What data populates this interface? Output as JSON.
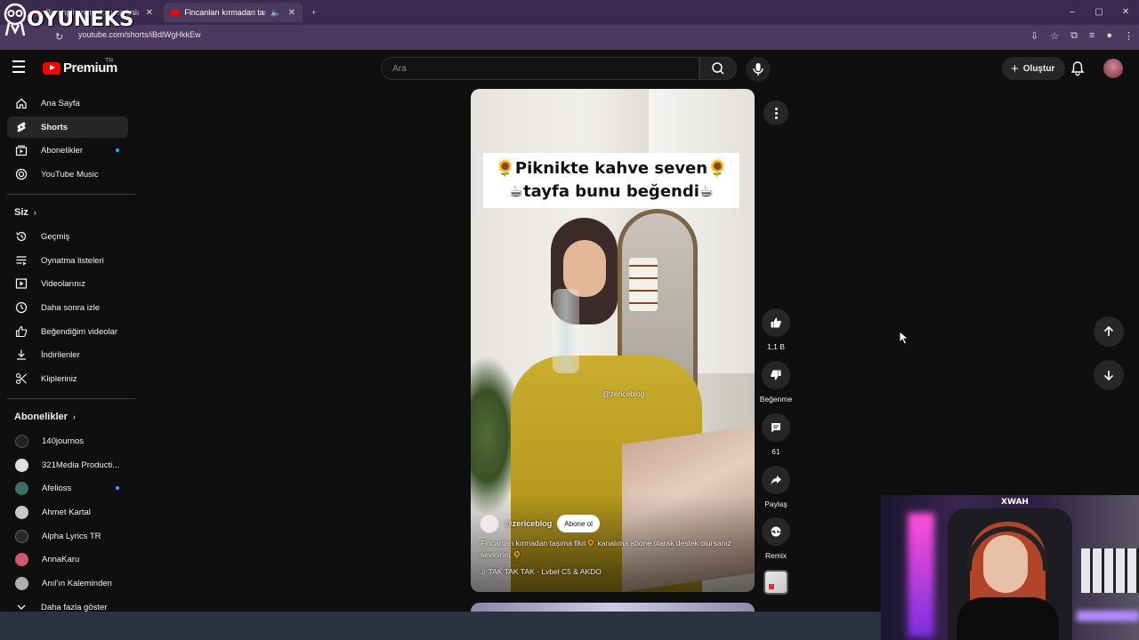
{
  "browser": {
    "tabs": [
      {
        "label": "Bu çhpli anime kızı zorbalanm...",
        "active": false
      },
      {
        "label": "Fincanları kırmadan taşıma",
        "active": true
      }
    ],
    "url": "youtube.com/shorts/iBdlWgHkkEw",
    "new_tab": "+",
    "window_controls": [
      "–",
      "▢",
      "✕"
    ]
  },
  "overlay_watermark": "OYUNEKS",
  "masthead": {
    "logo_text": "Premium",
    "country_code": "TR",
    "search_placeholder": "Ara",
    "create_label": "Oluştur"
  },
  "sidebar": {
    "main": [
      {
        "label": "Ana Sayfa",
        "icon": "home-icon"
      },
      {
        "label": "Shorts",
        "icon": "shorts-icon",
        "active": true
      },
      {
        "label": "Abonelikler",
        "icon": "subscriptions-icon",
        "dot": true
      },
      {
        "label": "YouTube Music",
        "icon": "music-icon"
      }
    ],
    "you_header": "Siz",
    "you": [
      {
        "label": "Geçmiş",
        "icon": "history-icon"
      },
      {
        "label": "Oynatma listeleri",
        "icon": "playlist-icon"
      },
      {
        "label": "Videolarınız",
        "icon": "your-videos-icon"
      },
      {
        "label": "Daha sonra izle",
        "icon": "watch-later-icon"
      },
      {
        "label": "Beğendiğim videolar",
        "icon": "liked-icon"
      },
      {
        "label": "İndirilenler",
        "icon": "download-icon"
      },
      {
        "label": "Klipleriniz",
        "icon": "clips-icon"
      }
    ],
    "subs_header": "Abonelikler",
    "subs": [
      {
        "label": "140journos",
        "color": "#222222"
      },
      {
        "label": "321Media Producti...",
        "color": "#e0e0e0"
      },
      {
        "label": "Afelioss",
        "color": "#3a6e6a",
        "dot": true
      },
      {
        "label": "Ahmet Kartal",
        "color": "#c8c8c8"
      },
      {
        "label": "Alpha Lyrics TR",
        "color": "#2a2a2a"
      },
      {
        "label": "AnnaKaru",
        "color": "#d05a6a"
      },
      {
        "label": "Anıl'ın Kaleminden",
        "color": "#b0b0b0"
      }
    ],
    "show_more": "Daha fazla göster"
  },
  "short": {
    "caption_line1": "🌻Piknikte kahve seven🌻",
    "caption_line2": "☕tayfa bunu beğendi☕",
    "video_watermark": "@zericeblog",
    "channel_handle": "@zericeblog",
    "subscribe_label": "Abone ol",
    "description": "Fincanları kırmadan taşıma fikri🌻 kanalıma abone olarak destek olursanız sevinirim 🌻",
    "music": "TAK TAK TAK · Lvbel C5 & AKDO"
  },
  "actions": {
    "likes": "1,1 B",
    "dislike_label": "Beğenme",
    "comments": "61",
    "share_label": "Paylaş",
    "remix_label": "Remix"
  },
  "webcam": {
    "chair_brand": "XWAH"
  }
}
